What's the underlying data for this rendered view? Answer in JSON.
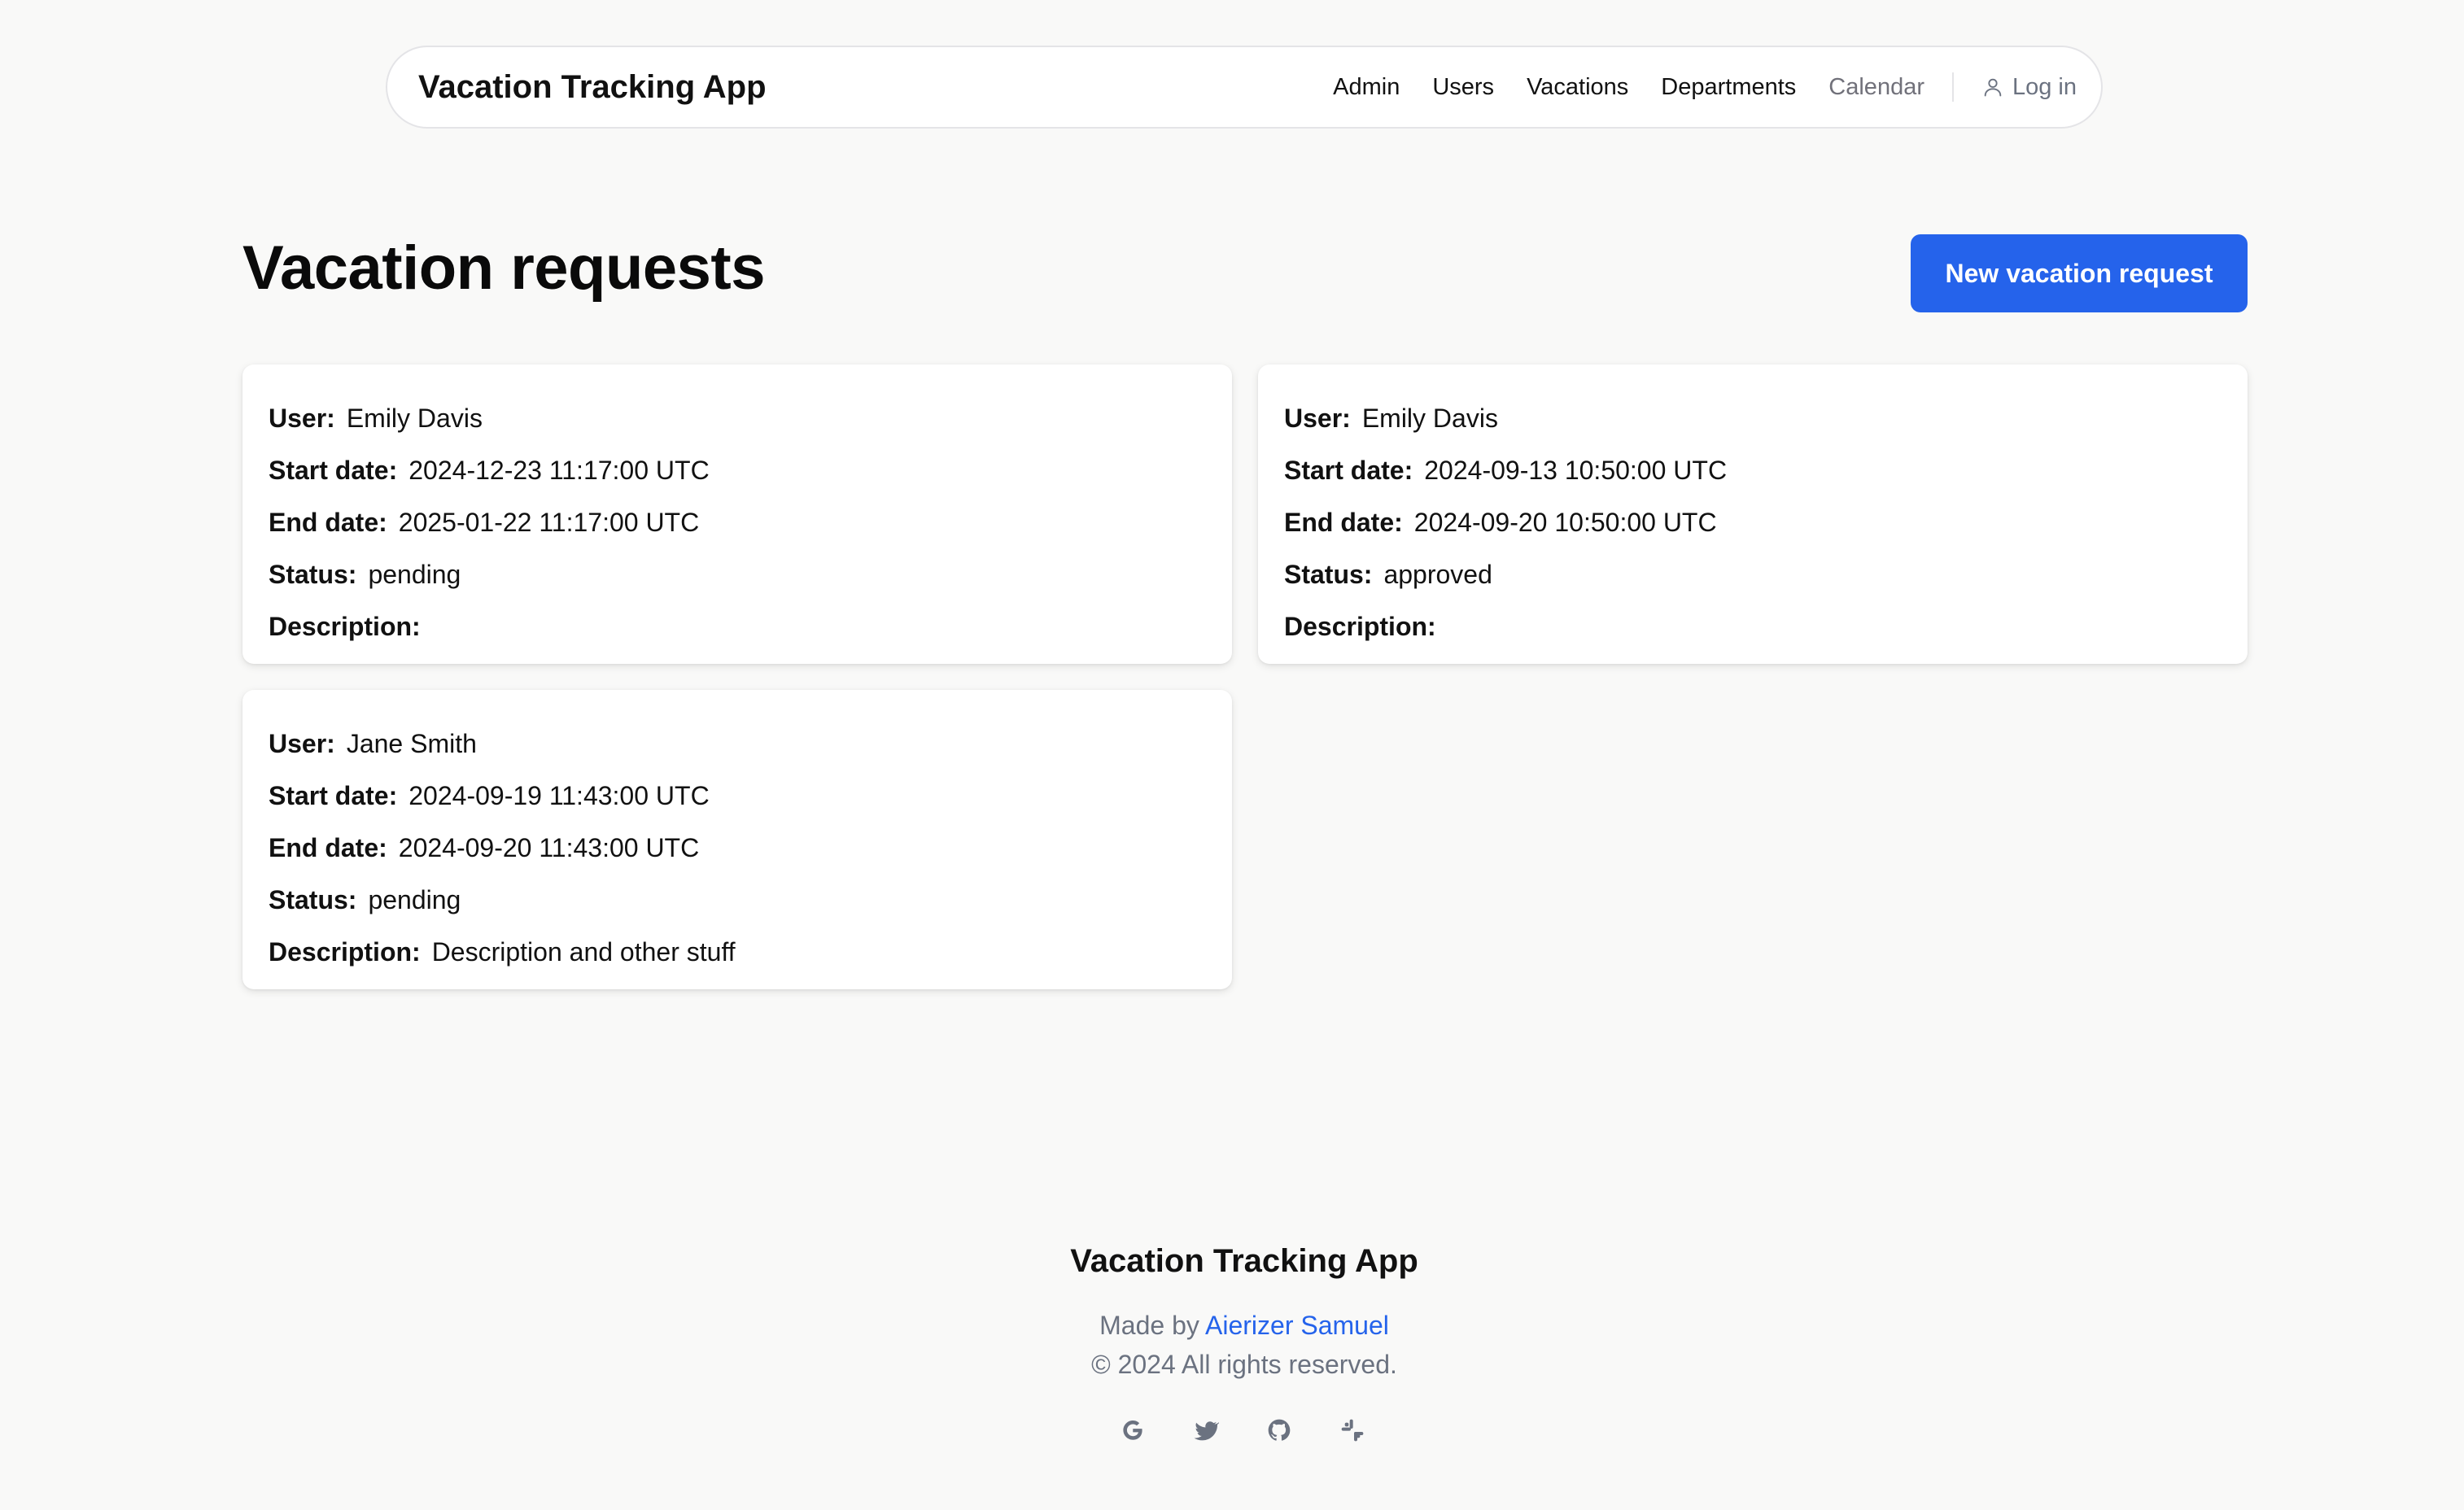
{
  "navbar": {
    "brand": "Vacation Tracking App",
    "links": [
      "Admin",
      "Users",
      "Vacations",
      "Departments",
      "Calendar"
    ],
    "login": "Log in"
  },
  "header": {
    "title": "Vacation requests",
    "new_button": "New vacation request"
  },
  "labels": {
    "user": "User:",
    "start": "Start date:",
    "end": "End date:",
    "status": "Status:",
    "description": "Description:"
  },
  "requests": [
    {
      "user": "Emily Davis",
      "start": "2024-12-23 11:17:00 UTC",
      "end": "2025-01-22 11:17:00 UTC",
      "status": "pending",
      "description": ""
    },
    {
      "user": "Emily Davis",
      "start": "2024-09-13 10:50:00 UTC",
      "end": "2024-09-20 10:50:00 UTC",
      "status": "approved",
      "description": ""
    },
    {
      "user": "Jane Smith",
      "start": "2024-09-19 11:43:00 UTC",
      "end": "2024-09-20 11:43:00 UTC",
      "status": "pending",
      "description": "Description and other stuff"
    }
  ],
  "footer": {
    "title": "Vacation Tracking App",
    "made_by": "Made by",
    "author": "Aierizer Samuel",
    "copyright": "© 2024 All rights reserved.",
    "socials": [
      "google-icon",
      "twitter-icon",
      "github-icon",
      "slack-icon"
    ]
  },
  "colors": {
    "accent": "#2563eb",
    "background": "#f9f9f8",
    "muted_text": "#6b7280"
  }
}
